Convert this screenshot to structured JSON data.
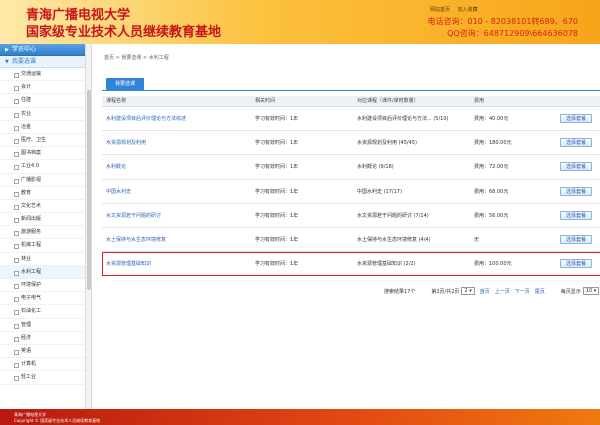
{
  "header": {
    "title_line1": "青海广播电视大学",
    "title_line2": "国家级专业技术人员继续教育基地",
    "link_home": "网站首页",
    "link_other": "加入收藏",
    "phone": "电话咨询：010 - 82038101转689、670",
    "qq": "QQ咨询：648712909\\664636078"
  },
  "sidebar": {
    "head1": "学员中心",
    "head2": "我要选课",
    "items": [
      {
        "label": "交通运输"
      },
      {
        "label": "会计"
      },
      {
        "label": "住建"
      },
      {
        "label": "农业"
      },
      {
        "label": "冶金"
      },
      {
        "label": "医疗、卫生"
      },
      {
        "label": "图书档案"
      },
      {
        "label": "工业4.0"
      },
      {
        "label": "广播影视"
      },
      {
        "label": "教育"
      },
      {
        "label": "文化艺术"
      },
      {
        "label": "新闻出版"
      },
      {
        "label": "旅游服务"
      },
      {
        "label": "机械工程"
      },
      {
        "label": "林业"
      },
      {
        "label": "水利工程"
      },
      {
        "label": "环境保护"
      },
      {
        "label": "电子电气"
      },
      {
        "label": "石油化工"
      },
      {
        "label": "管理"
      },
      {
        "label": "经济"
      },
      {
        "label": "英语"
      },
      {
        "label": "计算机"
      },
      {
        "label": "轻工业"
      }
    ],
    "active_index": 15
  },
  "main": {
    "breadcrumb": "首页 > 我要选课 > 水利工程",
    "tab_label": "我要选课",
    "columns": [
      "课程名称",
      "相关时间",
      "对应课程（课件/课时数量）",
      "费用",
      ""
    ],
    "rows": [
      {
        "name": "水利建设项目后评价理论与方法综述",
        "time": "学习有效时间：1年",
        "course": "水利建设项目后评价理论与方法... (5/10)",
        "fee": "费用：40.00元",
        "action": "选择套餐"
      },
      {
        "name": "水资源规划及利用",
        "time": "学习有效时间：1年",
        "course": "水资源规划及利用 (45/45)",
        "fee": "费用：180.00元",
        "action": "选择套餐"
      },
      {
        "name": "水利概论",
        "time": "学习有效时间：1年",
        "course": "水利概论 (9/18)",
        "fee": "费用：72.00元",
        "action": "选择套餐"
      },
      {
        "name": "中国水利史",
        "time": "学习有效时间：1年",
        "course": "中国水利史 (17/17)",
        "fee": "费用：68.00元",
        "action": "选择套餐"
      },
      {
        "name": "水文资源若干问题的研讨",
        "time": "学习有效时间：1年",
        "course": "水文资源若干问题的研讨 (7/14)",
        "fee": "费用：56.00元",
        "action": "选择套餐"
      },
      {
        "name": "水土保持与水生态环境修复",
        "time": "学习有效时间：1年",
        "course": "水土保持与水生态环境修复 (4/4)",
        "fee": "无",
        "action": "选择套餐"
      },
      {
        "name": "水资源管理基础知识",
        "time": "学习有效时间：1年",
        "course": "水资源管理基础知识 (2/2)",
        "fee": "费用：100.00元",
        "action": "选择套餐"
      }
    ],
    "highlight_row_index": 6
  },
  "pager": {
    "summary": "搜索结果17个",
    "page_info": "第2页/共2页",
    "page_select": "2",
    "first": "首页",
    "prev": "上一页",
    "next": "下一页",
    "last": "尾页",
    "per_page_label": "每页显示",
    "per_page_value": "10"
  },
  "footer": {
    "line1": "青海广播电视大学",
    "line2": "Copyright © 国家级专业技术人员继续教育基地"
  }
}
